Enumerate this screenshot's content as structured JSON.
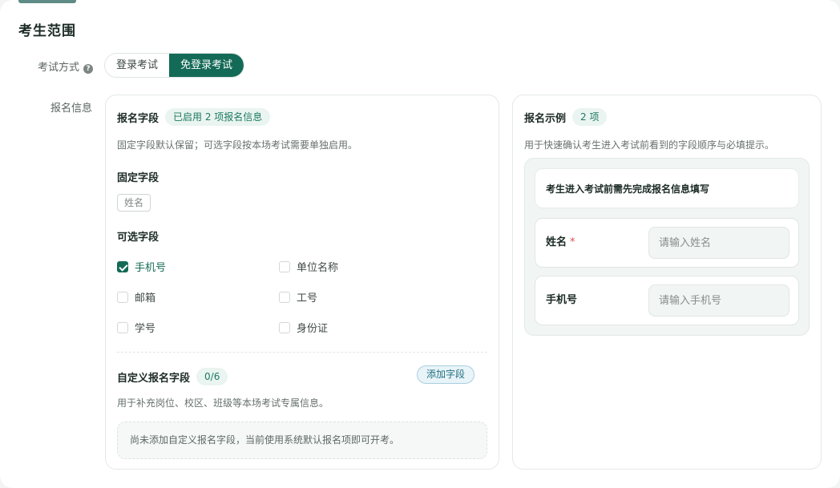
{
  "section": {
    "title": "考生范围"
  },
  "exam_mode": {
    "label": "考试方式",
    "help_icon": "?",
    "options": [
      "登录考试",
      "免登录考试"
    ],
    "selected": "免登录考试"
  },
  "registration": {
    "label": "报名信息",
    "fields_card": {
      "title": "报名字段",
      "badge": "已启用 2 项报名信息",
      "description": "固定字段默认保留；可选字段按本场考试需要单独启用。",
      "fixed_title": "固定字段",
      "fixed_fields": [
        "姓名"
      ],
      "optional_title": "可选字段",
      "optional_fields": [
        {
          "label": "手机号",
          "checked": true
        },
        {
          "label": "单位名称",
          "checked": false
        },
        {
          "label": "邮箱",
          "checked": false
        },
        {
          "label": "工号",
          "checked": false
        },
        {
          "label": "学号",
          "checked": false
        },
        {
          "label": "身份证",
          "checked": false
        }
      ],
      "custom_title": "自定义报名字段",
      "custom_count": "0/6",
      "add_button": "添加字段",
      "custom_description": "用于补充岗位、校区、班级等本场考试专属信息。",
      "empty_text": "尚未添加自定义报名字段，当前使用系统默认报名项即可开考。"
    },
    "preview_card": {
      "title": "报名示例",
      "badge": "2 项",
      "description": "用于快速确认考生进入考试前看到的字段顺序与必填提示。",
      "notice": "考生进入考试前需先完成报名信息填写",
      "fields": [
        {
          "label": "姓名",
          "required_mark": "*",
          "placeholder": "请输入姓名"
        },
        {
          "label": "手机号",
          "required_mark": "",
          "placeholder": "请输入手机号"
        }
      ]
    }
  },
  "colors": {
    "accent": "#136a57",
    "badge_bg": "#eaf4f0",
    "required": "#e05252"
  }
}
